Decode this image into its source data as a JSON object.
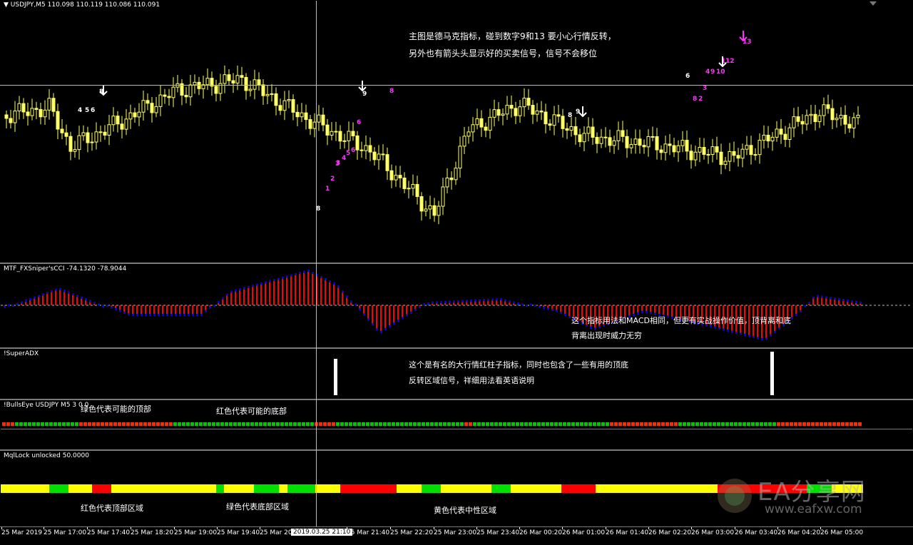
{
  "main": {
    "symbol_line": "USDJPY,M5  110.098 110.119 110.086 110.091",
    "note_line1": "主图是德马克指标，碰到数字9和13 要小心行情反转，",
    "note_line2": "另外也有箭头头显示好的买卖信号，信号不会移位",
    "td_labels": [
      "8",
      "4",
      "5",
      "6",
      "9",
      "3",
      "6",
      "8",
      "1",
      "2",
      "3",
      "4",
      "5",
      "6",
      "8",
      "9",
      "8",
      "6",
      "8",
      "2",
      "3",
      "4",
      "9",
      "10",
      "11",
      "12",
      "13"
    ]
  },
  "cci": {
    "label": "MTF_FXSniper'sCCI  -74.1320 -78.9044",
    "note_line1": "这个指标用法和MACD相同，但更有实战操作价值，顶背离和底",
    "note_line2": "背离出现时威力无穷",
    "colors": {
      "red": "#ff0000",
      "blue": "#0000ff"
    }
  },
  "adx": {
    "label": "!SuperADX",
    "note_line1": "这个是有名的大行情红柱子指标，同时也包含了一些有用的顶底",
    "note_line2": "反转区域信号，祥细用法看英语说明"
  },
  "bulls": {
    "label": "!BullsEye USDJPY M5 3 0 0",
    "note_top": "绿色代表可能的顶部",
    "note_bottom": "红色代表可能的底部",
    "colors": {
      "green": "#00c800",
      "red": "#ff2a00"
    }
  },
  "mql": {
    "label": "MqlLock  unlocked 50.0000",
    "note_a": "红色代表顶部区域",
    "note_b": "绿色代表底部区域",
    "note_c": "黄色代表中性区域",
    "colors": {
      "yellow": "#ffff00",
      "green": "#00e000",
      "red": "#ff0000"
    }
  },
  "xaxis": {
    "labels": [
      "25 Mar 2019",
      "25 Mar 17:00",
      "25 Mar 17:40",
      "25 Mar 18:20",
      "25 Mar 19:00",
      "25 Mar 19:40",
      "25 Mar 20:",
      "25 Mar 21:40",
      "25 Mar 22:20",
      "25 Mar 23:00",
      "25 Mar 23:40",
      "26 Mar 00:20",
      "26 Mar 01:00",
      "26 Mar 01:40",
      "26 Mar 02:20",
      "26 Mar 03:00",
      "26 Mar 03:40",
      "26 Mar 04:20",
      "26 Mar 05:00"
    ],
    "crosshair_time": "2019.03.25 21:10"
  },
  "watermark": {
    "brand": "EA分享网",
    "url": "www.eafxw.com"
  }
}
